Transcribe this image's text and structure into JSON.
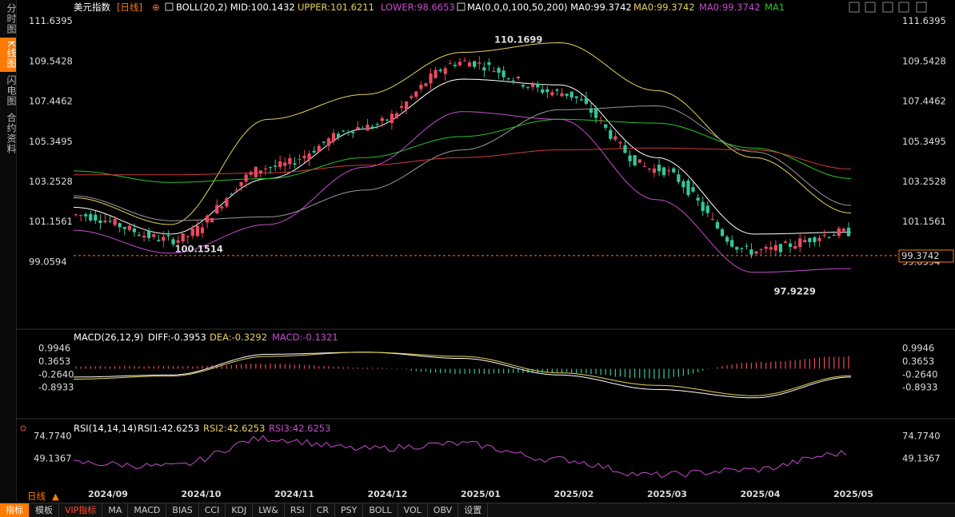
{
  "sidebar": {
    "tabs": [
      {
        "label": "分时图",
        "active": false
      },
      {
        "label": "K线图",
        "active": true
      },
      {
        "label": "闪电图",
        "active": false
      },
      {
        "label": "合约资料",
        "active": false
      }
    ]
  },
  "header": {
    "symbol": "美元指数",
    "period": "[日线]",
    "boll": "BOLL(20,2) MID:100.1432",
    "upper": "UPPER:101.6211",
    "lower": "LOWER:98.6653",
    "ma": "MA(0,0,0,100,50,200) MA0:99.3742",
    "ma0a": "MA0:99.3742",
    "ma0b": "MA0:99.3742",
    "ma1": "MA1"
  },
  "macd_header": {
    "name": "MACD(26,12,9)",
    "diff": "DIFF:-0.3953",
    "dea": "DEA:-0.3292",
    "macd": "MACD:-0.1321"
  },
  "rsi_header": {
    "name": "RSI(14,14,14)",
    "rsi1": "RSI1:42.6253",
    "rsi2": "RSI2:42.6253",
    "rsi3": "RSI3:42.6253"
  },
  "annotations": {
    "high": "110.1699",
    "low1": "100.1514",
    "low2": "97.9229",
    "last_price": "99.3742"
  },
  "period_label": "日线",
  "bottom_tabs": [
    "指标",
    "模板",
    "VIP指标",
    "MA",
    "MACD",
    "BIAS",
    "CCI",
    "KDJ",
    "LW&",
    "RSI",
    "CR",
    "PSY",
    "BOLL",
    "VOL",
    "OBV",
    "设置"
  ],
  "colors": {
    "up": "#e84a5f",
    "down": "#35c79a",
    "upper": "#e6d25a",
    "lower": "#c84bd0",
    "mid": "#ffffff",
    "ma100": "#9a9a9a",
    "ma50": "#26c426",
    "ma200": "#d03a3a",
    "accent": "#ff7a00"
  },
  "chart_data": [
    {
      "type": "candlestick",
      "title": "美元指数 [日线]",
      "y_ticks": [
        "111.6395",
        "109.5428",
        "107.4462",
        "105.3495",
        "103.2528",
        "101.1561",
        "99.0594"
      ],
      "ylim": [
        97.7,
        111.9
      ],
      "x_ticks": [
        "2024/09",
        "2024/10",
        "2024/11",
        "2024/12",
        "2025/01",
        "2025/02",
        "2025/03",
        "2025/04",
        "2025/05"
      ],
      "key_points": [
        {
          "date": "2024/09",
          "close": 101.5
        },
        {
          "date": "2024/10",
          "close": 100.2
        },
        {
          "date": "2024/11",
          "close": 104.0
        },
        {
          "date": "2024/12",
          "close": 106.1
        },
        {
          "date": "2025/01",
          "close": 109.5
        },
        {
          "date": "2025/02",
          "close": 107.9
        },
        {
          "date": "2025/03",
          "close": 103.9
        },
        {
          "date": "2025/04",
          "close": 99.6
        },
        {
          "date": "2025/05",
          "close": 100.6
        }
      ],
      "series": [
        {
          "name": "BOLL",
          "values": [
            101.9,
            100.5,
            103.4,
            106.0,
            108.6,
            108.3,
            104.5,
            100.5,
            100.6
          ]
        },
        {
          "name": "UPPER",
          "values": [
            102.4,
            101.0,
            106.5,
            107.8,
            110.0,
            110.5,
            108.0,
            104.5,
            101.6
          ]
        },
        {
          "name": "LOWER",
          "values": [
            100.7,
            99.5,
            101.0,
            104.0,
            106.9,
            106.5,
            102.3,
            98.5,
            98.7
          ]
        },
        {
          "name": "MA0",
          "values": [
            102.5,
            101.2,
            101.4,
            102.8,
            104.9,
            107.0,
            107.2,
            104.8,
            102.0
          ]
        },
        {
          "name": "MA0",
          "values": [
            103.8,
            103.2,
            103.4,
            104.5,
            105.6,
            106.5,
            106.3,
            105.0,
            103.4
          ]
        },
        {
          "name": "MA1",
          "values": [
            103.6,
            103.6,
            103.7,
            104.1,
            104.5,
            104.9,
            105.0,
            104.9,
            103.9
          ]
        }
      ],
      "high_point": {
        "value": 110.1699,
        "date": "2025/01"
      },
      "low_points": [
        {
          "value": 100.1514,
          "date": "2024/10"
        },
        {
          "value": 97.9229,
          "date": "2025/04"
        }
      ],
      "last_price": 99.3742
    },
    {
      "type": "line",
      "title": "MACD(26,12,9)",
      "y_ticks": [
        "0.9946",
        "0.3653",
        "-0.2640",
        "-0.8933"
      ],
      "series": [
        {
          "name": "DIFF",
          "values": [
            -0.4,
            -0.3,
            0.7,
            0.8,
            0.5,
            -0.3,
            -1.0,
            -1.4,
            -0.4
          ]
        },
        {
          "name": "DEA",
          "values": [
            -0.5,
            -0.35,
            0.6,
            0.8,
            0.6,
            -0.2,
            -0.8,
            -1.3,
            -0.33
          ]
        },
        {
          "name": "MACD",
          "values": [
            0.1,
            0.1,
            0.2,
            0.05,
            -0.2,
            -0.15,
            -0.4,
            0.25,
            0.5
          ]
        }
      ],
      "last": {
        "DIFF": -0.3953,
        "DEA": -0.3292,
        "MACD": -0.1321
      }
    },
    {
      "type": "line",
      "title": "RSI(14,14,14)",
      "y_ticks": [
        "74.7740",
        "49.1367"
      ],
      "series": [
        {
          "name": "RSI1",
          "values": [
            44,
            40,
            72,
            60,
            66,
            48,
            30,
            36,
            55
          ]
        }
      ],
      "last": {
        "RSI1": 42.6253,
        "RSI2": 42.6253,
        "RSI3": 42.6253
      }
    }
  ]
}
